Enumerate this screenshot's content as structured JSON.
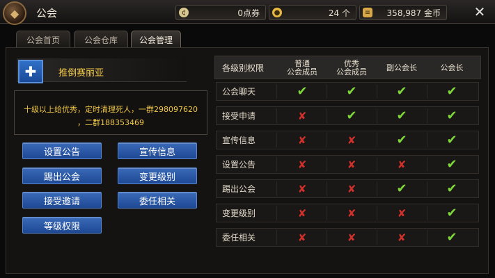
{
  "header": {
    "title": "公会",
    "coupon": "0点券",
    "gold_ingot": "24 个",
    "gold_coin": "358,987 金币",
    "close_icon": "close-icon"
  },
  "tabs": [
    {
      "label": "公会首页"
    },
    {
      "label": "公会仓库"
    },
    {
      "label": "公会管理"
    }
  ],
  "guild": {
    "name": "推倒赛丽亚",
    "notice_line1": "十级以上给优秀，定时清理死人，一群298097620",
    "notice_line2": "，二群188353469"
  },
  "buttons": {
    "set_notice": "设置公告",
    "publicity": "宣传信息",
    "kick": "踢出公会",
    "change_rank": "变更级别",
    "accept_invite": "接受邀请",
    "appoint": "委任相关",
    "rank_perms": "等级权限"
  },
  "table": {
    "headers": {
      "perm": "各级别权限",
      "normal_l1": "普通",
      "normal_l2": "公会成员",
      "excellent_l1": "优秀",
      "excellent_l2": "公会成员",
      "vice": "副公会长",
      "leader": "公会长"
    },
    "rows": [
      {
        "name": "公会聊天",
        "v": [
          true,
          true,
          true,
          true
        ]
      },
      {
        "name": "接受申请",
        "v": [
          false,
          true,
          true,
          true
        ]
      },
      {
        "name": "宣传信息",
        "v": [
          false,
          false,
          true,
          true
        ]
      },
      {
        "name": "设置公告",
        "v": [
          false,
          false,
          false,
          true
        ]
      },
      {
        "name": "踢出公会",
        "v": [
          false,
          false,
          true,
          true
        ]
      },
      {
        "name": "变更级别",
        "v": [
          false,
          false,
          false,
          true
        ]
      },
      {
        "name": "委任相关",
        "v": [
          false,
          false,
          false,
          true
        ]
      }
    ]
  },
  "colors": {
    "check": "#7ed83a",
    "cross": "#d0302a",
    "accent": "#f0c848"
  }
}
